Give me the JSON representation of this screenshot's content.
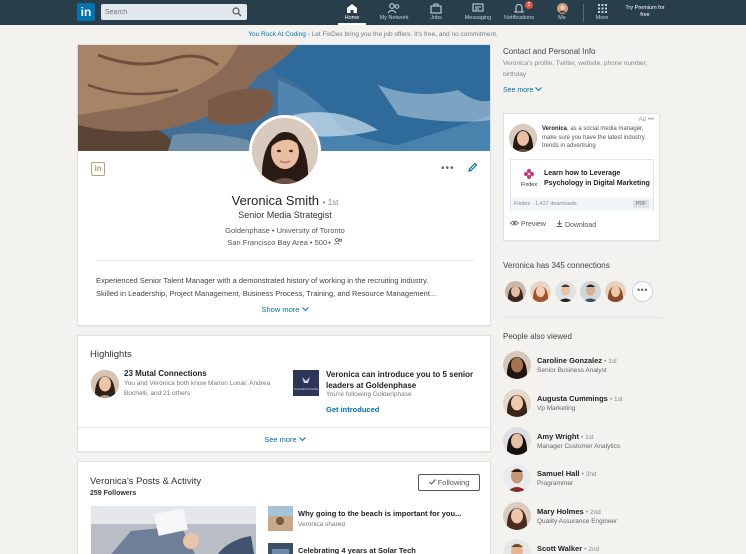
{
  "nav": {
    "logo": "in",
    "search_placeholder": "Search",
    "items": [
      {
        "label": "Home",
        "icon": "home-icon"
      },
      {
        "label": "My Network",
        "icon": "network-icon"
      },
      {
        "label": "Jobs",
        "icon": "briefcase-icon"
      },
      {
        "label": "Messaging",
        "icon": "message-icon"
      },
      {
        "label": "Notifications",
        "icon": "bell-icon",
        "badge": "2"
      },
      {
        "label": "Me",
        "icon": "avatar"
      },
      {
        "label": "More",
        "icon": "grid-icon"
      }
    ],
    "premium": "Try Premium for free"
  },
  "promo": {
    "brand": "You Rock At Coding",
    "text": " - Let FixDex bring you the job offers. It's free, and no commitment."
  },
  "profile": {
    "name": "Veronica Smith",
    "degree": "• 1st",
    "title": "Senior Media Strategist",
    "company_school": "Goldenphase • University of Toronto",
    "location": "San Francisco Bay Area • 500+",
    "summary_line1": "Experienced Senior Talent Manager with a demonstrated history of working in the recruiting industry.",
    "summary_line2": "Skilled in Leadership, Project Management, Business Process, Training, and Resource Management...",
    "show_more": "Show more"
  },
  "highlights": {
    "title": "Highlights",
    "item1_title": "23 Mutal Connections",
    "item1_desc": "You and Veronica both know Marion Lunar, Andrea Bochelli, and 21 others",
    "item2_title": "Veronica can introduce you to 5 senior leaders at Goldenphase",
    "item2_desc": "You're following Goldenphase",
    "item2_link": "Get introduced",
    "logo_text": "GOLDEN PHASE",
    "see_more": "See more"
  },
  "activity": {
    "title": "Veronica's Posts & Activity",
    "followers": "259 Followers",
    "following_button": "Following",
    "post1_title": "Why going to the beach is important for you...",
    "post1_sub": "Veronica shared",
    "post2_title": "Celebrating 4 years at Solar Tech"
  },
  "contact": {
    "heading": "Contact and Personal Info",
    "text": "Veronica's profile, Twitter, website, phone number, birthday",
    "see_more": "See more"
  },
  "ad": {
    "label": "Ad",
    "name": "Veronica",
    "text": ", as a social media manager, make sure you have the latest industry trends in advertising",
    "doc_title": "Learn how to Leverage Psychology in Digital Marketing",
    "doc_brand": "Fixdex",
    "doc_footer": "Fixdex  ·  1,427 downloads",
    "doc_type": "PDF",
    "preview": "Preview",
    "download": "Download"
  },
  "connections": {
    "heading": "Veronica has 345 connections"
  },
  "people_also_viewed": {
    "heading": "People also viewed",
    "people": [
      {
        "name": "Caroline Gonzalez",
        "degree": "• 1st",
        "role": "Senior Business Analyst"
      },
      {
        "name": "Augusta Cummings",
        "degree": "• 1st",
        "role": "Vp Marketing"
      },
      {
        "name": "Amy Wright",
        "degree": "• 1st",
        "role": "Manager Customer Analytics"
      },
      {
        "name": "Samuel Hall",
        "degree": "• 2nd",
        "role": "Programmer"
      },
      {
        "name": "Mary Holmes",
        "degree": "• 2nd",
        "role": "Quality Assurance Engineer"
      },
      {
        "name": "Scott Walker",
        "degree": "• 2nd",
        "role": ""
      }
    ]
  },
  "colors": {
    "nav_bg": "#283e4a",
    "brand_blue": "#0073b1",
    "page_bg": "#f3f2ef"
  }
}
